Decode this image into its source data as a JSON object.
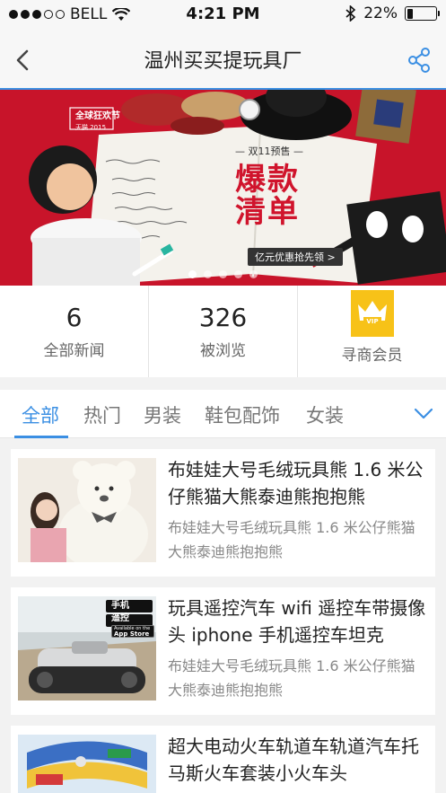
{
  "status_bar": {
    "carrier": "BELL",
    "time": "4:21 PM",
    "battery": "22%",
    "battery_level": 0.22
  },
  "nav": {
    "title": "温州买买提玩具厂"
  },
  "banner": {
    "brand": "全球狂欢节",
    "brand_sub": "天猫 2015",
    "tagline": "— 双11预售 —",
    "headline_line1": "爆款",
    "headline_line2": "清单",
    "coupon": "亿元优惠抢先领 >",
    "pager_count": 5,
    "pager_active": 0
  },
  "stats": [
    {
      "value": "6",
      "label": "全部新闻"
    },
    {
      "value": "326",
      "label": "被浏览"
    },
    {
      "label": "寻商会员",
      "badge": "VIP"
    }
  ],
  "tabs": [
    "全部",
    "热门",
    "男装",
    "鞋包配饰",
    "女装"
  ],
  "active_tab": "全部",
  "items": [
    {
      "title": "布娃娃大号毛绒玩具熊 1.6 米公仔熊猫大熊泰迪熊抱抱熊",
      "desc": "布娃娃大号毛绒玩具熊 1.6 米公仔熊猫大熊泰迪熊抱抱熊"
    },
    {
      "title": "玩具遥控汽车 wifi 遥控车带摄像头 iphone 手机遥控车坦克",
      "desc": "布娃娃大号毛绒玩具熊 1.6 米公仔熊猫大熊泰迪熊抱抱熊",
      "thumb_text_1": "手机",
      "thumb_text_2": "遥控",
      "thumb_badge_small": "Available on the",
      "thumb_badge": "App Store"
    },
    {
      "title": "超大电动火车轨道车轨道汽车托马斯火车套装小火车头",
      "desc": ""
    }
  ],
  "colors": {
    "accent": "#3b8fe3",
    "banner_red": "#c8142a",
    "vip_gold": "#f7c218"
  }
}
